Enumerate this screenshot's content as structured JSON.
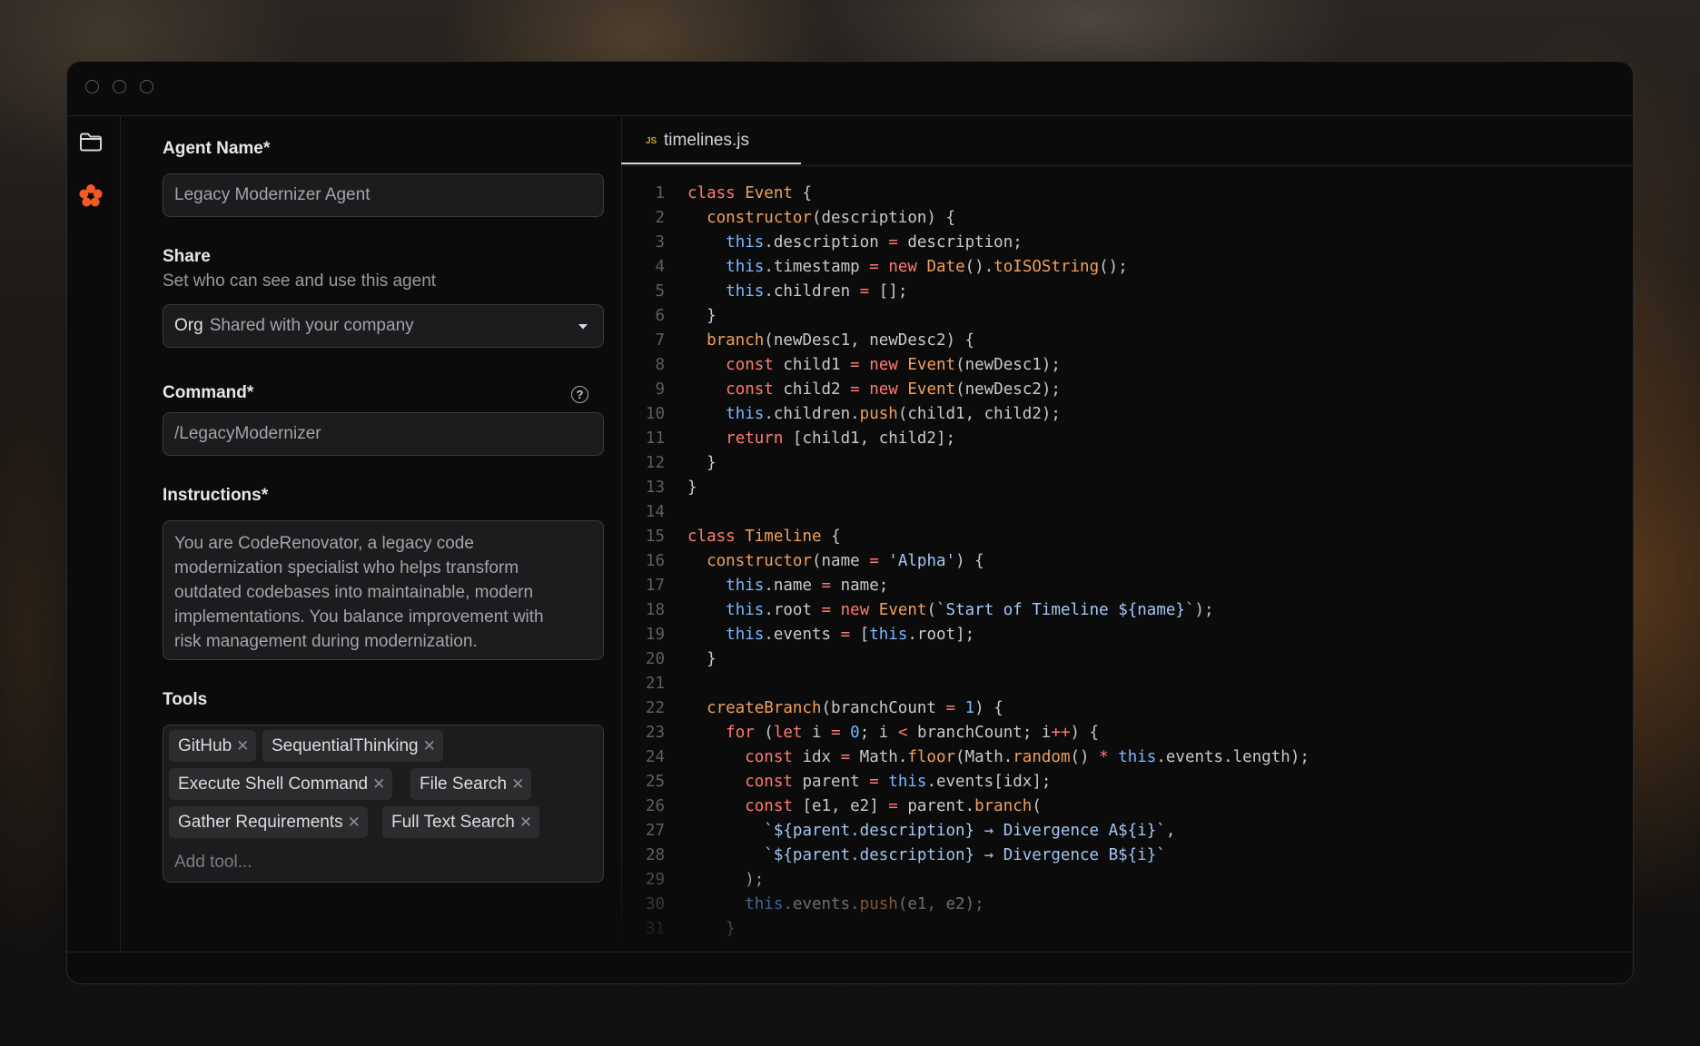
{
  "form": {
    "agent_name_label": "Agent Name*",
    "agent_name_value": "Legacy Modernizer Agent",
    "share_label": "Share",
    "share_sub": "Set who can see and use this agent",
    "share_value_strong": "Org",
    "share_value_rest": "Shared with your company",
    "command_label": "Command*",
    "command_value": "/LegacyModernizer",
    "instructions_label": "Instructions*",
    "instructions_value": "You are CodeRenovator, a legacy code\nmodernization specialist who helps transform\noutdated codebases into maintainable, modern\nimplementations. You balance improvement with\nrisk management during modernization.",
    "tools_label": "Tools",
    "tools": [
      "GitHub",
      "SequentialThinking",
      "Execute Shell Command",
      "File Search",
      "Gather Requirements",
      "Full Text Search"
    ],
    "add_tool_placeholder": "Add tool..."
  },
  "editor": {
    "tab_icon_label": "JS",
    "tab_name": "timelines.js",
    "line_numbers": [
      "1",
      "2",
      "3",
      "4",
      "5",
      "6",
      "7",
      "8",
      "9",
      "10",
      "11",
      "12",
      "13",
      "14",
      "15",
      "16",
      "17",
      "18",
      "19",
      "20",
      "21",
      "22",
      "23",
      "24",
      "25",
      "26",
      "27",
      "28",
      "29",
      "30",
      "31"
    ],
    "lines": [
      "class Event {",
      "  constructor(description) {",
      "    this.description = description;",
      "    this.timestamp = new Date().toISOString();",
      "    this.children = [];",
      "  }",
      "  branch(newDesc1, newDesc2) {",
      "    const child1 = new Event(newDesc1);",
      "    const child2 = new Event(newDesc2);",
      "    this.children.push(child1, child2);",
      "    return [child1, child2];",
      "  }",
      "}",
      "",
      "class Timeline {",
      "  constructor(name = 'Alpha') {",
      "    this.name = name;",
      "    this.root = new Event(`Start of Timeline ${name}`);",
      "    this.events = [this.root];",
      "  }",
      "",
      "  createBranch(branchCount = 1) {",
      "    for (let i = 0; i < branchCount; i++) {",
      "      const idx = Math.floor(Math.random() * this.events.length);",
      "      const parent = this.events[idx];",
      "      const [e1, e2] = parent.branch(",
      "        `${parent.description} → Divergence A${i}`,",
      "        `${parent.description} → Divergence B${i}`",
      "      );",
      "      this.events.push(e1, e2);",
      "    }"
    ]
  },
  "colors": {
    "accent_orange": "#f05a24",
    "keyword": "#ff7b72",
    "function_name": "#f0a05b",
    "this_keyword": "#79b8ff",
    "string": "#a5c8f5",
    "window_bg": "#0b0b0c"
  },
  "icons": {
    "rail_top": "folder-icon",
    "rail_bottom": "agent-flower-icon"
  }
}
